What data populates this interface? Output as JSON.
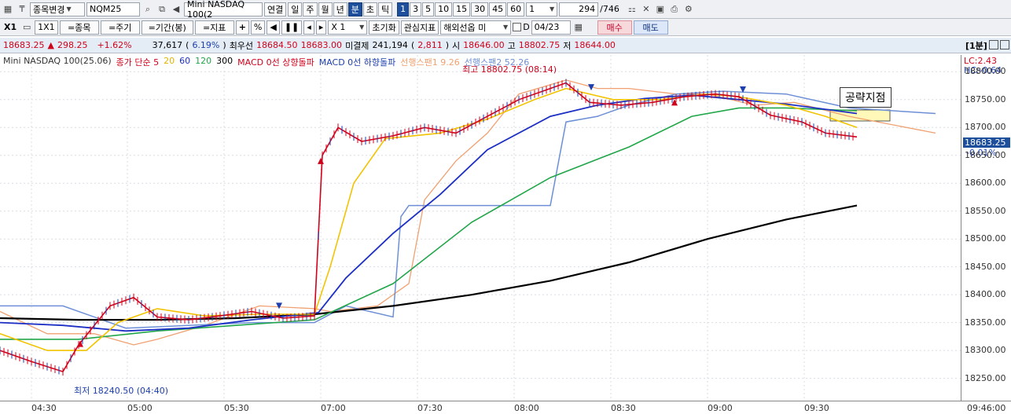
{
  "toolbar1": {
    "change_label": "종목변경",
    "symbol": "NQM25",
    "title_field": "Mini NASDAQ 100(2",
    "linked": "연결",
    "periods": [
      "일",
      "주",
      "월",
      "년",
      "분",
      "초",
      "틱"
    ],
    "active_period": "분",
    "intervals": [
      "1",
      "3",
      "5",
      "10",
      "15",
      "30",
      "45",
      "60"
    ],
    "active_interval": "1",
    "interval_value": "1",
    "count": "294",
    "total": "/746"
  },
  "toolbar2": {
    "x1": "X1",
    "one_by_one": "1X1",
    "symbol_btn": "=종목",
    "period_btn": "=주기",
    "range_btn": "=기간(봉)",
    "indicator_btn": "=지표",
    "plus": "+",
    "percent": "%",
    "zoom": "X 1",
    "reset": "초기화",
    "fav_indicator": "관심지표",
    "overseas": "해외선옵 미",
    "date_d": "D",
    "date": "04/23",
    "buy": "매수",
    "sell": "매도"
  },
  "info": {
    "price": "18683.25",
    "change": "298.25",
    "change_pct": "+1.62%",
    "volume": "37,617",
    "volume_pct": "6.19%",
    "best_ask_label": "최우선",
    "best_ask": "18684.50",
    "best_bid": "18683.00",
    "open_interest_label": "미결제",
    "open_interest": "241,194",
    "open_interest_chg": "2,811",
    "open_label": "시",
    "open": "18646.00",
    "high_label": "고",
    "high": "18802.75",
    "low_label": "저",
    "low": "18644.00",
    "timeframe": "[1분]"
  },
  "legend": {
    "name": "Mini NASDAQ 100(25.06)",
    "ma_label": "종가 단순 5",
    "ma20": "20",
    "ma60": "60",
    "ma120": "120",
    "ma300": "300",
    "macd_up": "MACD 0선 상향돌파",
    "macd_down": "MACD 0선 하향돌파",
    "span1": "선행스팬1 9.26",
    "span2": "선행스팬2 52.26"
  },
  "annotations": {
    "high_note": "최고 18802.75 (08:14)",
    "low_note": "최저 18240.50 (04:40)",
    "target_box": "공략지점",
    "lc": "LC:2.43",
    "hc": "HC:-0.64",
    "current_price": "18683.25",
    "current_pct": "-0.01%"
  },
  "colors": {
    "candle": "#d0021b",
    "ma5": "#d0021b",
    "ma20": "#f2c300",
    "ma60": "#1d2fc4",
    "ma120": "#22a64a",
    "ma300": "#000000",
    "span1": "#f0a070",
    "span2": "#6d8fd6"
  },
  "chart_data": {
    "type": "line",
    "title": "",
    "xlabel": "",
    "ylabel": "",
    "ylim": [
      18210,
      18830
    ],
    "x_ticks": [
      "04:30",
      "05:00",
      "05:30",
      "07:00",
      "07:30",
      "08:00",
      "08:30",
      "09:00",
      "09:30",
      "09:46:00"
    ],
    "y_ticks": [
      18800,
      18750,
      18700,
      18650,
      18600,
      18550,
      18500,
      18450,
      18400,
      18350,
      18300,
      18250
    ],
    "y_tick_labels": [
      "18800.00",
      "18750.00",
      "18700.00",
      "18650.00",
      "18600.00",
      "18550.00",
      "18500.00",
      "18450.00",
      "18400.00",
      "18350.00",
      "18300.00",
      "18250.00"
    ],
    "series": [
      {
        "name": "종가 단순 5",
        "key": "ma5",
        "values": [
          [
            0,
            18300
          ],
          [
            40,
            18280
          ],
          [
            80,
            18262
          ],
          [
            100,
            18310
          ],
          [
            140,
            18380
          ],
          [
            170,
            18395
          ],
          [
            200,
            18360
          ],
          [
            240,
            18355
          ],
          [
            280,
            18362
          ],
          [
            320,
            18370
          ],
          [
            360,
            18358
          ],
          [
            400,
            18362
          ],
          [
            410,
            18650
          ],
          [
            430,
            18700
          ],
          [
            460,
            18675
          ],
          [
            500,
            18685
          ],
          [
            540,
            18700
          ],
          [
            580,
            18690
          ],
          [
            620,
            18720
          ],
          [
            660,
            18750
          ],
          [
            700,
            18770
          ],
          [
            720,
            18780
          ],
          [
            750,
            18745
          ],
          [
            790,
            18740
          ],
          [
            830,
            18745
          ],
          [
            870,
            18755
          ],
          [
            910,
            18760
          ],
          [
            940,
            18755
          ],
          [
            980,
            18722
          ],
          [
            1020,
            18710
          ],
          [
            1050,
            18690
          ],
          [
            1090,
            18683
          ]
        ]
      },
      {
        "name": "20",
        "key": "ma20",
        "values": [
          [
            0,
            18330
          ],
          [
            60,
            18300
          ],
          [
            110,
            18300
          ],
          [
            150,
            18350
          ],
          [
            200,
            18375
          ],
          [
            260,
            18362
          ],
          [
            330,
            18365
          ],
          [
            400,
            18365
          ],
          [
            420,
            18450
          ],
          [
            450,
            18600
          ],
          [
            490,
            18680
          ],
          [
            560,
            18690
          ],
          [
            620,
            18715
          ],
          [
            680,
            18750
          ],
          [
            720,
            18770
          ],
          [
            780,
            18750
          ],
          [
            840,
            18750
          ],
          [
            900,
            18760
          ],
          [
            940,
            18755
          ],
          [
            1000,
            18740
          ],
          [
            1050,
            18720
          ],
          [
            1090,
            18700
          ]
        ]
      },
      {
        "name": "60",
        "key": "ma60",
        "values": [
          [
            0,
            18350
          ],
          [
            80,
            18345
          ],
          [
            160,
            18335
          ],
          [
            240,
            18340
          ],
          [
            320,
            18355
          ],
          [
            405,
            18368
          ],
          [
            440,
            18430
          ],
          [
            500,
            18510
          ],
          [
            560,
            18580
          ],
          [
            620,
            18660
          ],
          [
            700,
            18720
          ],
          [
            760,
            18740
          ],
          [
            820,
            18752
          ],
          [
            880,
            18758
          ],
          [
            940,
            18750
          ],
          [
            1000,
            18742
          ],
          [
            1090,
            18725
          ]
        ]
      },
      {
        "name": "120",
        "key": "ma120",
        "values": [
          [
            0,
            18320
          ],
          [
            100,
            18320
          ],
          [
            200,
            18335
          ],
          [
            300,
            18345
          ],
          [
            400,
            18355
          ],
          [
            500,
            18420
          ],
          [
            600,
            18530
          ],
          [
            700,
            18610
          ],
          [
            800,
            18665
          ],
          [
            880,
            18720
          ],
          [
            940,
            18735
          ],
          [
            1000,
            18735
          ],
          [
            1090,
            18730
          ]
        ]
      },
      {
        "name": "300",
        "key": "ma300",
        "values": [
          [
            0,
            18358
          ],
          [
            100,
            18355
          ],
          [
            200,
            18355
          ],
          [
            300,
            18358
          ],
          [
            400,
            18365
          ],
          [
            500,
            18380
          ],
          [
            600,
            18400
          ],
          [
            700,
            18425
          ],
          [
            800,
            18458
          ],
          [
            900,
            18500
          ],
          [
            1000,
            18535
          ],
          [
            1090,
            18560
          ]
        ]
      },
      {
        "name": "선행스팬1 9.26",
        "key": "span1",
        "values": [
          [
            0,
            18370
          ],
          [
            60,
            18330
          ],
          [
            120,
            18330
          ],
          [
            170,
            18310
          ],
          [
            200,
            18320
          ],
          [
            260,
            18345
          ],
          [
            330,
            18380
          ],
          [
            400,
            18375
          ],
          [
            420,
            18370
          ],
          [
            480,
            18380
          ],
          [
            520,
            18420
          ],
          [
            540,
            18570
          ],
          [
            580,
            18640
          ],
          [
            620,
            18690
          ],
          [
            660,
            18760
          ],
          [
            720,
            18785
          ],
          [
            760,
            18770
          ],
          [
            800,
            18770
          ],
          [
            860,
            18760
          ],
          [
            900,
            18760
          ],
          [
            960,
            18740
          ],
          [
            1010,
            18745
          ],
          [
            1080,
            18720
          ],
          [
            1190,
            18690
          ]
        ]
      },
      {
        "name": "선행스팬2 52.26",
        "key": "span2",
        "values": [
          [
            0,
            18380
          ],
          [
            80,
            18380
          ],
          [
            160,
            18340
          ],
          [
            240,
            18345
          ],
          [
            320,
            18350
          ],
          [
            400,
            18350
          ],
          [
            440,
            18380
          ],
          [
            500,
            18360
          ],
          [
            510,
            18540
          ],
          [
            520,
            18560
          ],
          [
            600,
            18560
          ],
          [
            700,
            18560
          ],
          [
            720,
            18710
          ],
          [
            760,
            18720
          ],
          [
            800,
            18740
          ],
          [
            860,
            18760
          ],
          [
            920,
            18765
          ],
          [
            1000,
            18760
          ],
          [
            1080,
            18735
          ],
          [
            1190,
            18725
          ]
        ]
      }
    ]
  }
}
